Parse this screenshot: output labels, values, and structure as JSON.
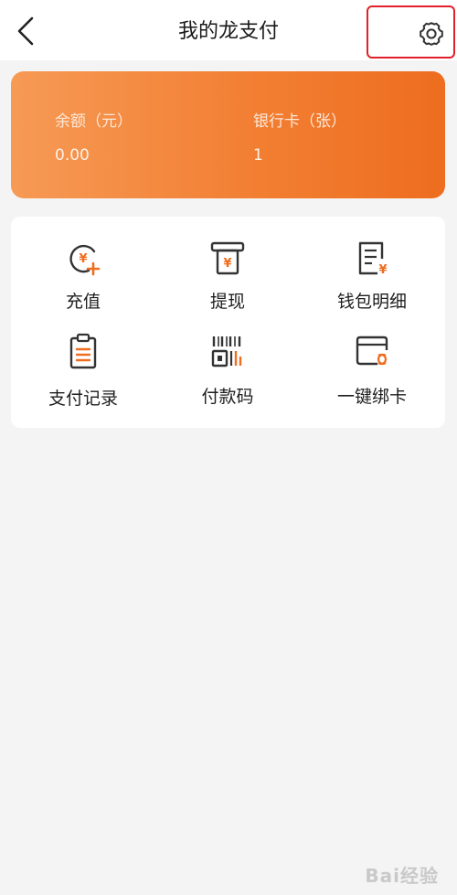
{
  "header": {
    "title": "我的龙支付"
  },
  "balance": {
    "balance_label": "余额（元）",
    "balance_value": "0.00",
    "cards_label": "银行卡（张）",
    "cards_value": "1"
  },
  "menu": {
    "items": [
      {
        "label": "充值",
        "icon": "recharge-icon"
      },
      {
        "label": "提现",
        "icon": "withdraw-icon"
      },
      {
        "label": "钱包明细",
        "icon": "wallet-detail-icon"
      },
      {
        "label": "支付记录",
        "icon": "payment-record-icon"
      },
      {
        "label": "付款码",
        "icon": "payment-code-icon"
      },
      {
        "label": "一键绑卡",
        "icon": "bind-card-icon"
      }
    ]
  },
  "watermark": {
    "text": "Bai经验"
  },
  "colors": {
    "accent": "#f27f33",
    "highlight_box": "#e0202a",
    "background": "#f4f4f4"
  }
}
